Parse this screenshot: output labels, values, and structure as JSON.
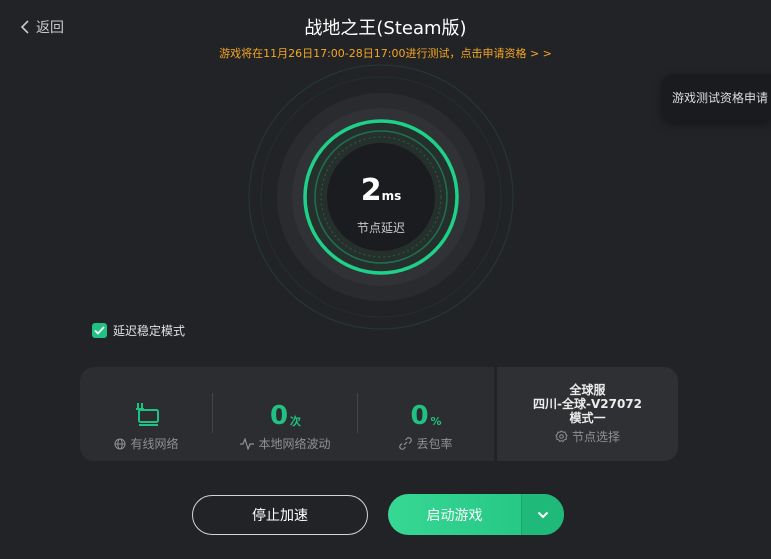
{
  "header": {
    "back_label": "返回",
    "title": "战地之王(Steam版)",
    "notice": "游戏将在11月26日17:00-28日17:00进行测试，点击申请资格 > >"
  },
  "side_tab": {
    "label": "游戏测试资格申请"
  },
  "gauge": {
    "value": "2",
    "unit": "ms",
    "label": "节点延迟"
  },
  "stable_mode": {
    "label": "延迟稳定模式",
    "checked": true
  },
  "stats": {
    "network": {
      "label": "有线网络",
      "icon": "ethernet-icon"
    },
    "fluctuation": {
      "value": "0",
      "unit": "次",
      "label": "本地网络波动"
    },
    "packet_loss": {
      "value": "0",
      "unit": "%",
      "label": "丢包率"
    }
  },
  "server": {
    "line1": "全球服",
    "line2": "四川-全球-V27072",
    "line3": "模式一",
    "select_label": "节点选择"
  },
  "actions": {
    "stop_label": "停止加速",
    "start_label": "启动游戏"
  },
  "colors": {
    "accent": "#1fc283",
    "notice": "#f5a623",
    "background": "#222326"
  }
}
